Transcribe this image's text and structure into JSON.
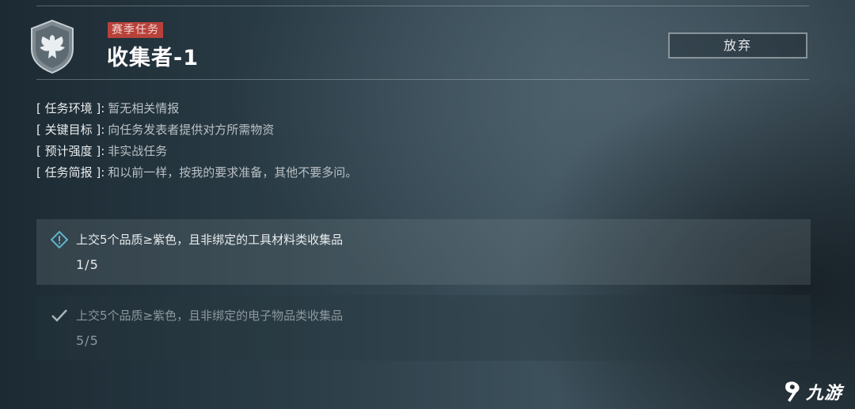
{
  "mission": {
    "tag": "赛季任务",
    "title": "收集者-1",
    "abandon_label": "放弃"
  },
  "info": [
    {
      "key": "[ 任务环境 ]:",
      "value": "暂无相关情报"
    },
    {
      "key": "[ 关键目标 ]:",
      "value": "向任务发表者提供对方所需物资"
    },
    {
      "key": "[ 预计强度 ]:",
      "value": "非实战任务"
    },
    {
      "key": "[ 任务简报 ]:",
      "value": "和以前一样，按我的要求准备，其他不要多问。"
    }
  ],
  "objectives": [
    {
      "text": "上交5个品质≥紫色，且非绑定的工具材料类收集品",
      "progress": "1/5",
      "status": "in-progress",
      "icon": "diamond-info-icon"
    },
    {
      "text": "上交5个品质≥紫色，且非绑定的电子物品类收集品",
      "progress": "5/5",
      "status": "completed",
      "icon": "check-icon"
    }
  ],
  "watermark": {
    "text": "九游"
  },
  "colors": {
    "tag_bg": "#b8423b",
    "accent_teal": "#5fb6c9"
  }
}
